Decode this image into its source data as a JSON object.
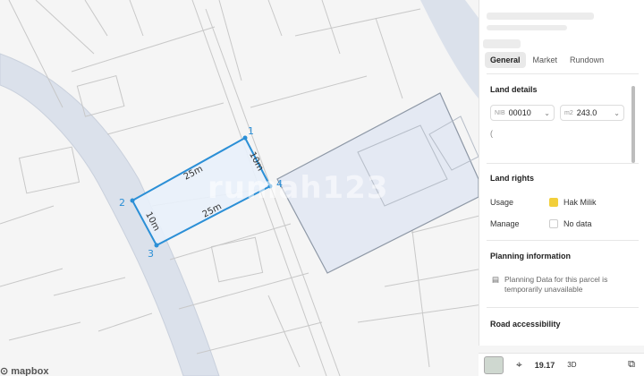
{
  "map": {
    "vertices": [
      "1",
      "2",
      "3",
      "4"
    ],
    "dimensions": [
      "25m",
      "10m",
      "25m",
      "10m"
    ],
    "watermark": "rumah123",
    "attribution": "mapbox"
  },
  "panel": {
    "tabs": [
      "General",
      "Market",
      "Rundown"
    ],
    "land_details": {
      "title": "Land details",
      "nib_prefix": "NIB",
      "nib_value": "00010",
      "area_prefix": "m2",
      "area_value": "243.0",
      "extra": "("
    },
    "land_rights": {
      "title": "Land rights",
      "usage_label": "Usage",
      "usage_value": "Hak Milik",
      "usage_color": "#f2cf3b",
      "manage_label": "Manage",
      "manage_value": "No data"
    },
    "planning": {
      "title": "Planning information",
      "note": "Planning Data for this parcel is temporarily unavailable"
    },
    "road": {
      "title": "Road accessibility"
    }
  },
  "bottombar": {
    "zoom": "19.17",
    "mode": "3D"
  },
  "colors": {
    "accent": "#2b8fd6",
    "parcel_fill": "#e6eef8",
    "road": "#d9dee9",
    "selected_building": "#e4e9f3"
  }
}
